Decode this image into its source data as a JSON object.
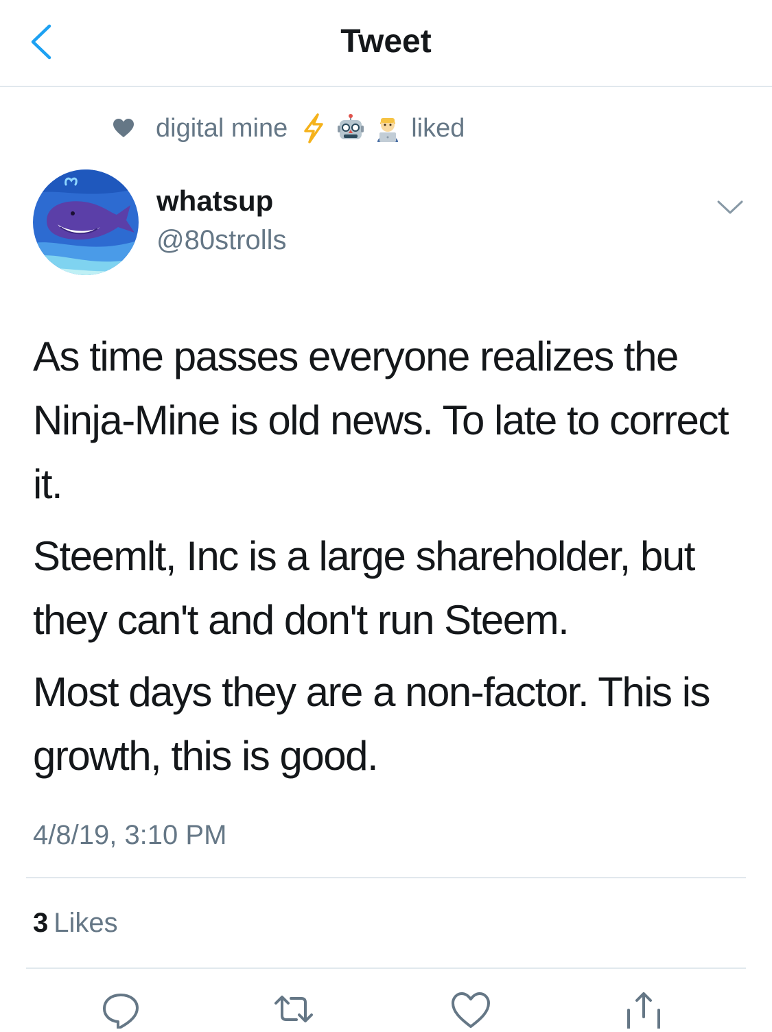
{
  "header": {
    "title": "Tweet",
    "back_icon": "chevron-left-icon"
  },
  "social_context": {
    "icon": "heart-icon",
    "name": "digital mine",
    "emojis": [
      "lightning-emoji",
      "robot-emoji",
      "technologist-emoji"
    ],
    "action": "liked"
  },
  "tweet": {
    "author": {
      "display_name": "whatsup",
      "handle": "@80strolls",
      "avatar": "whale-avatar"
    },
    "paragraphs": [
      "As time passes everyone realizes the Ninja-Mine is old news.  To late to correct it.",
      "Steemlt, Inc is a large shareholder, but they can't and don't run Steem.",
      "Most days they are a non-factor.  This is growth, this is good."
    ],
    "timestamp": "4/8/19, 3:10 PM",
    "likes_count": "3",
    "likes_label": "Likes"
  },
  "actions": [
    "reply-icon",
    "retweet-icon",
    "like-icon",
    "share-icon"
  ],
  "colors": {
    "accent": "#1da1f2",
    "text": "#14171a",
    "secondary": "#657786",
    "divider": "#e1e8ed"
  }
}
